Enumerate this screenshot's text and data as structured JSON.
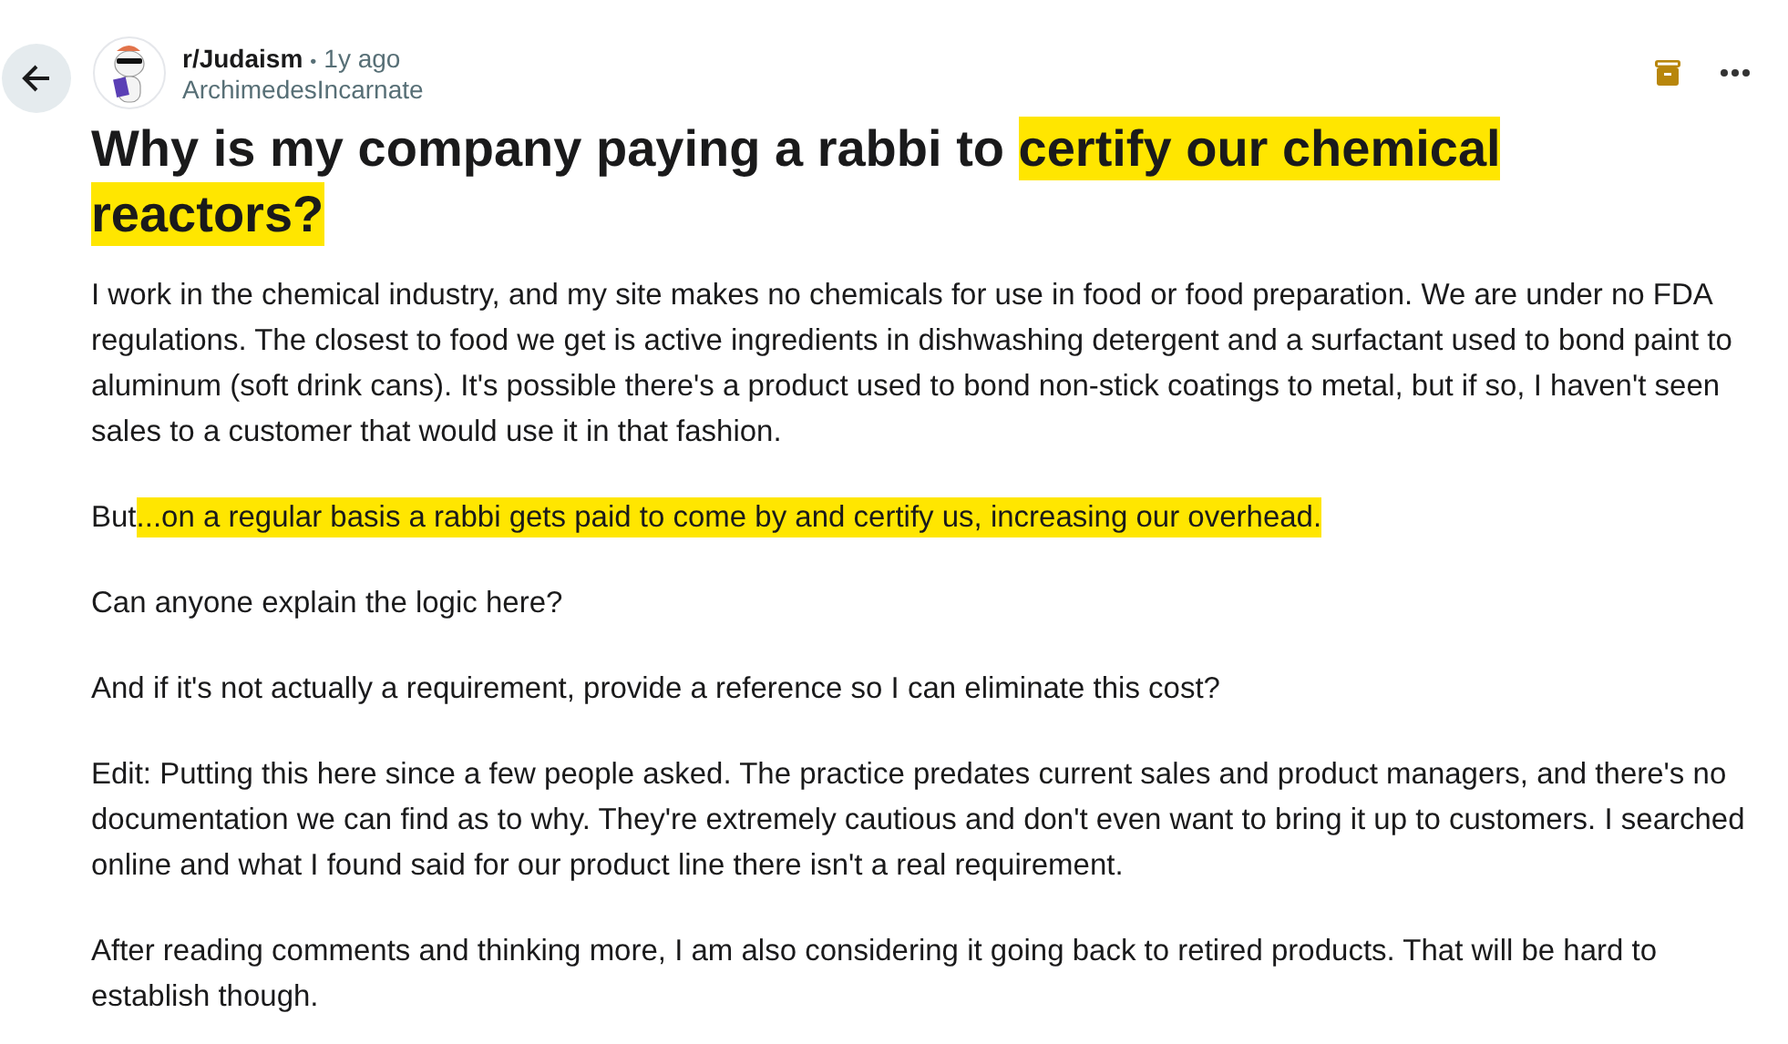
{
  "post": {
    "subreddit": "r/Judaism",
    "separator": "•",
    "age": "1y ago",
    "author": "ArchimedesIncarnate",
    "title": [
      {
        "text": "Why is my company paying a rabbi to",
        "highlighted": false
      },
      {
        "text": "certify our chemical reactors?",
        "highlighted": true
      }
    ],
    "paragraphs": [
      [
        {
          "text": "I work in the chemical industry, and my site makes no chemicals for use in food or food preparation. We are under no FDA regulations. The closest to food we get is active ingredients in dishwashing detergent and a surfactant used to bond paint to aluminum (soft drink cans). It's possible there's a product used to bond non-stick coatings to metal, but if so, I haven't seen sales to a customer that would use it in that fashion.",
          "highlighted": false
        }
      ],
      [
        {
          "text": "But",
          "highlighted": false
        },
        {
          "text": "...on a regular basis a rabbi gets paid to come by and certify us, increasing our overhead.",
          "highlighted": true
        }
      ],
      [
        {
          "text": "Can anyone explain the logic here?",
          "highlighted": false
        }
      ],
      [
        {
          "text": "And if it's not actually a requirement, provide a reference so I can eliminate this cost?",
          "highlighted": false
        }
      ],
      [
        {
          "text": "Edit: Putting this here since a few people asked. The practice predates current sales and product managers, and there's no documentation we can find as to why. They're extremely cautious and don't even want to bring it up to customers. I searched online and what I found said for our product line there isn't a real requirement.",
          "highlighted": false
        }
      ],
      [
        {
          "text": "After reading comments and thinking more, I am also considering it going back to retired products. That will be hard to establish though.",
          "highlighted": false
        }
      ]
    ]
  }
}
